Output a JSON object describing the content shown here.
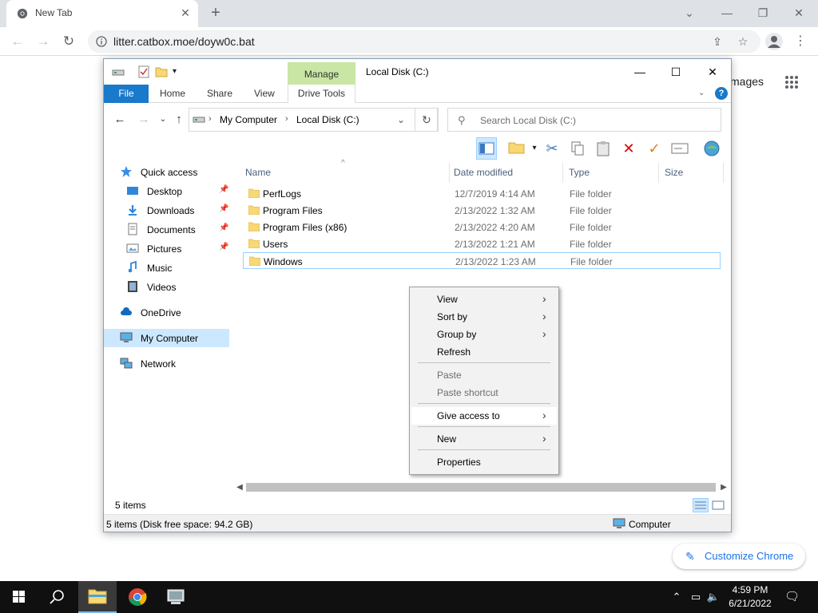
{
  "browser": {
    "tab_title": "New Tab",
    "tab_close": "✕",
    "new_tab": "+",
    "url": "litter.catbox.moe/doyw0c.bat",
    "ntp_images_link": "mages",
    "customize_label": "Customize Chrome"
  },
  "explorer": {
    "window_title": "Local Disk (C:)",
    "manage_label": "Manage",
    "ribbon_tabs": {
      "file": "File",
      "home": "Home",
      "share": "Share",
      "view": "View",
      "drive_tools": "Drive Tools"
    },
    "breadcrumb": [
      "My Computer",
      "Local Disk (C:)"
    ],
    "search_placeholder": "Search Local Disk (C:)",
    "navigation": [
      {
        "label": "Quick access",
        "icon": "star-icon"
      },
      {
        "label": "Desktop",
        "icon": "desktop-icon",
        "pinned": true
      },
      {
        "label": "Downloads",
        "icon": "download-icon",
        "pinned": true
      },
      {
        "label": "Documents",
        "icon": "document-icon",
        "pinned": true
      },
      {
        "label": "Pictures",
        "icon": "picture-icon",
        "pinned": true
      },
      {
        "label": "Music",
        "icon": "music-icon"
      },
      {
        "label": "Videos",
        "icon": "video-icon"
      },
      {
        "label": "OneDrive",
        "icon": "cloud-icon"
      },
      {
        "label": "My Computer",
        "icon": "computer-icon",
        "selected": true
      },
      {
        "label": "Network",
        "icon": "network-icon"
      }
    ],
    "columns": {
      "name": "Name",
      "date": "Date modified",
      "type": "Type",
      "size": "Size"
    },
    "files": [
      {
        "name": "PerfLogs",
        "date": "12/7/2019 4:14 AM",
        "type": "File folder"
      },
      {
        "name": "Program Files",
        "date": "2/13/2022 1:32 AM",
        "type": "File folder"
      },
      {
        "name": "Program Files (x86)",
        "date": "2/13/2022 4:20 AM",
        "type": "File folder"
      },
      {
        "name": "Users",
        "date": "2/13/2022 1:21 AM",
        "type": "File folder"
      },
      {
        "name": "Windows",
        "date": "2/13/2022 1:23 AM",
        "type": "File folder"
      }
    ],
    "status_count": "5 items",
    "status_detail": "5 items (Disk free space: 94.2 GB)",
    "status_location": "Computer"
  },
  "context_menu": {
    "items": [
      {
        "label": "View",
        "submenu": true
      },
      {
        "label": "Sort by",
        "submenu": true
      },
      {
        "label": "Group by",
        "submenu": true
      },
      {
        "label": "Refresh"
      },
      {
        "label": "Paste",
        "disabled": true
      },
      {
        "label": "Paste shortcut",
        "disabled": true
      },
      {
        "label": "Give access to",
        "submenu": true,
        "hover": true
      },
      {
        "label": "New",
        "submenu": true
      },
      {
        "label": "Properties"
      }
    ]
  },
  "taskbar": {
    "time": "4:59 PM",
    "date": "6/21/2022"
  },
  "colors": {
    "accent_blue": "#1979ca",
    "manage_green": "#c9e6a4",
    "selection": "#cce8ff",
    "folder_yellow": "#f8d775",
    "chrome_link": "#1a73e8"
  }
}
